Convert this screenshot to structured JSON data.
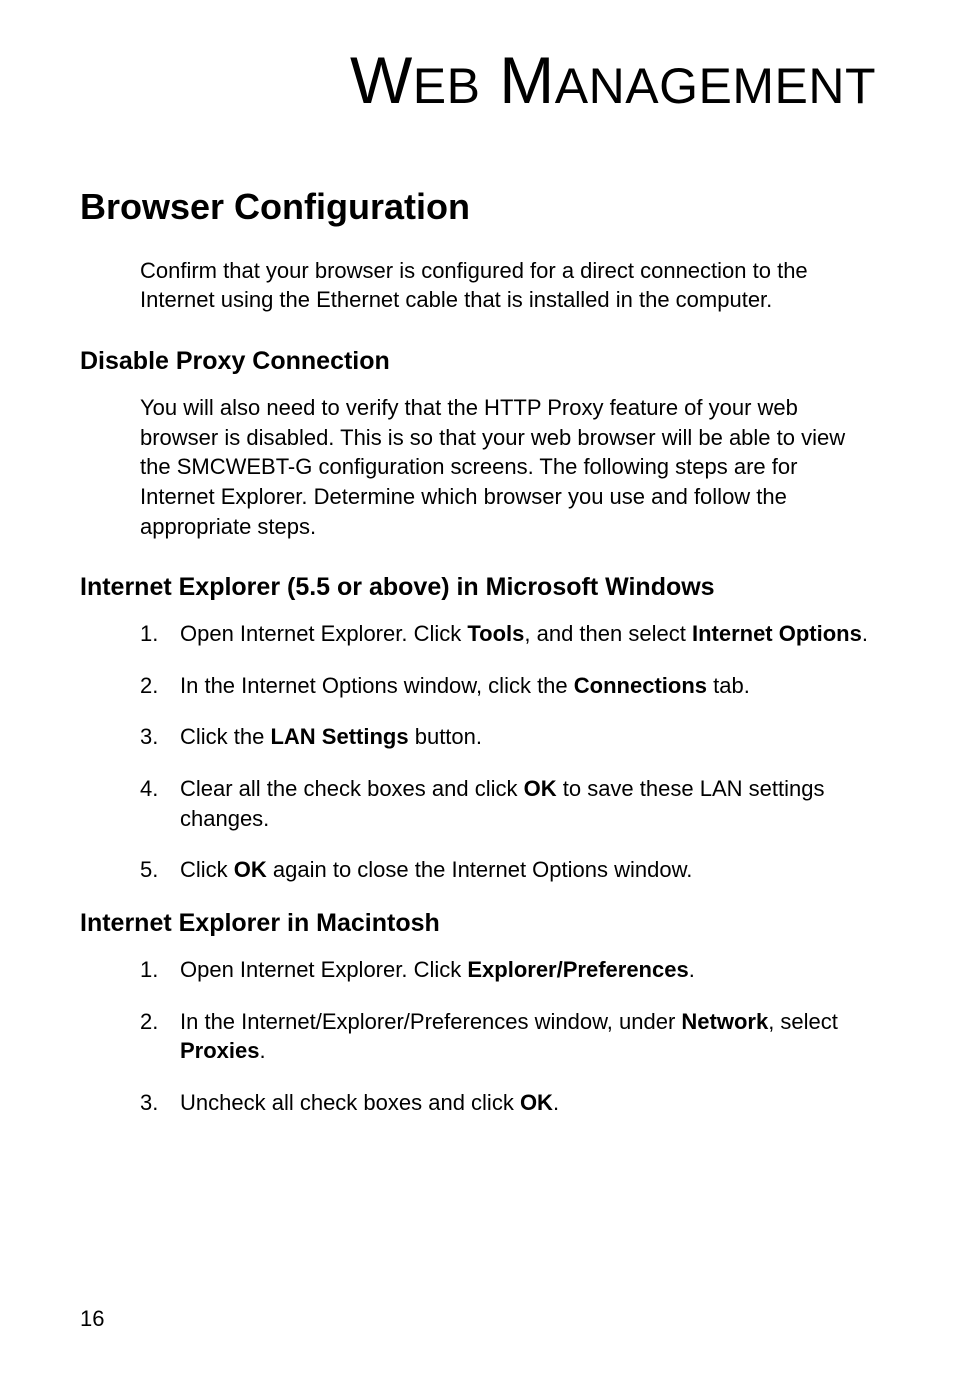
{
  "chapter_title_1": "W",
  "chapter_title_2": "EB",
  "chapter_title_3": " M",
  "chapter_title_4": "ANAGEMENT",
  "h1": "Browser Configuration",
  "intro": "Confirm that your browser is configured for a direct connection to the Internet using the Ethernet cable that is installed in the computer.",
  "sec1_h": "Disable Proxy Connection",
  "sec1_p": "You will also need to verify that the HTTP Proxy feature of your web browser is disabled. This is so that your web browser will be able to view the SMCWEBT-G configuration screens. The following steps are for Internet Explorer. Determine which browser you use and follow the appropriate steps.",
  "sec2_h": "Internet Explorer (5.5 or above) in Microsoft Windows",
  "sec2_li1_a": "Open Internet Explorer. Click ",
  "sec2_li1_b": "Tools",
  "sec2_li1_c": ", and then select ",
  "sec2_li1_d": "Internet Options",
  "sec2_li1_e": ".",
  "sec2_li2_a": "In the Internet Options window, click the ",
  "sec2_li2_b": "Connections",
  "sec2_li2_c": " tab.",
  "sec2_li3_a": "Click the ",
  "sec2_li3_b": "LAN Settings",
  "sec2_li3_c": " button.",
  "sec2_li4_a": "Clear all the check boxes and click ",
  "sec2_li4_b": "OK",
  "sec2_li4_c": " to save these LAN settings changes.",
  "sec2_li5_a": "Click ",
  "sec2_li5_b": "OK",
  "sec2_li5_c": " again to close the Internet Options window.",
  "sec3_h": "Internet Explorer in Macintosh",
  "sec3_li1_a": "Open Internet Explorer. Click ",
  "sec3_li1_b": "Explorer/Preferences",
  "sec3_li1_c": ".",
  "sec3_li2_a": "In the Internet/Explorer/Preferences window, under ",
  "sec3_li2_b": "Network",
  "sec3_li2_c": ", select ",
  "sec3_li2_d": "Proxies",
  "sec3_li2_e": ".",
  "sec3_li3_a": "Uncheck all check boxes and click ",
  "sec3_li3_b": "OK",
  "sec3_li3_c": ".",
  "page_number": "16"
}
